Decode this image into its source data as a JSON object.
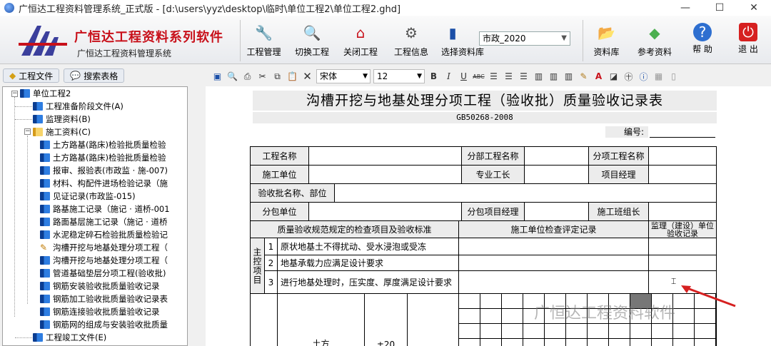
{
  "window": {
    "title": "广恒达工程资料管理系统_正式版 - [d:\\users\\yyz\\desktop\\临时\\单位工程2\\单位工程2.ghd]",
    "minimize": "—",
    "maximize": "☐",
    "close": "✕"
  },
  "brand": {
    "main": "广恒达工程资料系列软件",
    "sub": "广恒达工程资料管理系统"
  },
  "toolbar": {
    "project_mgmt": "工程管理",
    "switch_project": "切换工程",
    "close_project": "关闭工程",
    "project_info": "工程信息",
    "select_library": "选择资料库",
    "library_value": "市政_2020",
    "library": "资料库",
    "reference": "参考资料",
    "help": "帮 助",
    "exit": "退 出"
  },
  "left_tabs": {
    "project_files": "工程文件",
    "search_tables": "搜索表格"
  },
  "tree": {
    "root": "单位工程2",
    "items": [
      "工程准备阶段文件(A)",
      "监理资料(B)",
      "施工资料(C)",
      "土方路基(路床)检验批质量检验",
      "土方路基(路床)检验批质量检验",
      "报审、报验表(市政监 · 施-007)",
      "材料、构配件进场检验记录（施",
      "见证记录(市政监-015)",
      "路基施工记录（施记 · 道桥-001",
      "路面基层施工记录（施记 · 道桥",
      "水泥稳定碎石检验批质量检验记",
      "沟槽开挖与地基处理分项工程（",
      "沟槽开挖与地基处理分项工程（",
      "管道基础垫层分项工程(验收批)",
      "钢筋安装验收批质量验收记录",
      "钢筋加工验收批质量验收记录表",
      "钢筋连接验收批质量验收记录",
      "钢筋网的组成与安装验收批质量",
      "工程竣工文件(E)"
    ]
  },
  "editor": {
    "font": "宋体",
    "size": "12",
    "bold": "B",
    "italic": "I",
    "underline": "U",
    "strike": "ABC"
  },
  "doc": {
    "title": "沟槽开挖与地基处理分项工程（验收批）质量验收记录表",
    "standard": "GB50268-2008",
    "number_label": "编号:",
    "project_name": "工程名称",
    "sub_project_name": "分部工程名称",
    "item_project_name": "分项工程名称",
    "construction_unit": "施工单位",
    "tech_lead": "专业工长",
    "project_manager": "项目经理",
    "batch_name": "验收批名称、部位",
    "subcontractor": "分包单位",
    "sub_pm": "分包项目经理",
    "team_lead": "施工班组长",
    "col_standard": "质量验收规范规定的检查项目及验收标准",
    "col_check": "施工单位检查评定记录",
    "col_supervision": "监理（建设）单位验收记录",
    "main_items_label": "主控项目",
    "rows": [
      {
        "no": "1",
        "text": "原状地基土不得扰动、受水浸泡或受冻"
      },
      {
        "no": "2",
        "text": "地基承载力应满足设计要求"
      },
      {
        "no": "3",
        "text": "进行地基处理时，压实度、厚度满足设计要求"
      }
    ],
    "earthwork": "土方",
    "tolerance": "±20"
  },
  "watermark": "广恒达工程资料软件"
}
